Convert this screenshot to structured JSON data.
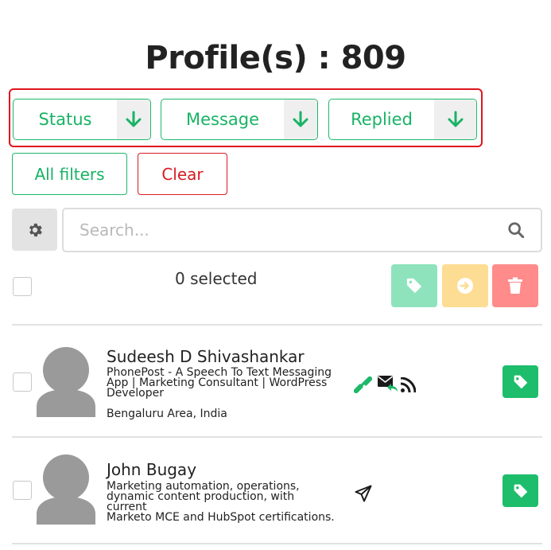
{
  "header": {
    "title": "Profile(s) : 809"
  },
  "filters": {
    "status_label": "Status",
    "message_label": "Message",
    "replied_label": "Replied",
    "all_filters_label": "All filters",
    "clear_label": "Clear"
  },
  "search": {
    "placeholder": "Search...",
    "value": ""
  },
  "selection": {
    "selected_text": "0 selected"
  },
  "colors": {
    "accent_green": "#1db86a",
    "danger_red": "#d81b22",
    "tag_action_bg": "#8ee3bd",
    "forward_action_bg": "#fddc93",
    "delete_action_bg": "#ff8b8b"
  },
  "profiles": [
    {
      "name": "Sudeesh D Shivashankar",
      "headline_lines": [
        "PhonePost - A Speech To Text Messaging",
        "App | Marketing Consultant | WordPress",
        "Developer"
      ],
      "location": "Bengaluru Area, India",
      "status_icons": [
        "link-icon",
        "envelope-reply-icon",
        "rss-icon"
      ]
    },
    {
      "name": "John Bugay",
      "headline_lines": [
        "Marketing automation, operations,",
        "dynamic content production, with current",
        "Marketo MCE and HubSpot certifications."
      ],
      "location": "",
      "status_icons": [
        "paper-plane-icon"
      ]
    }
  ]
}
